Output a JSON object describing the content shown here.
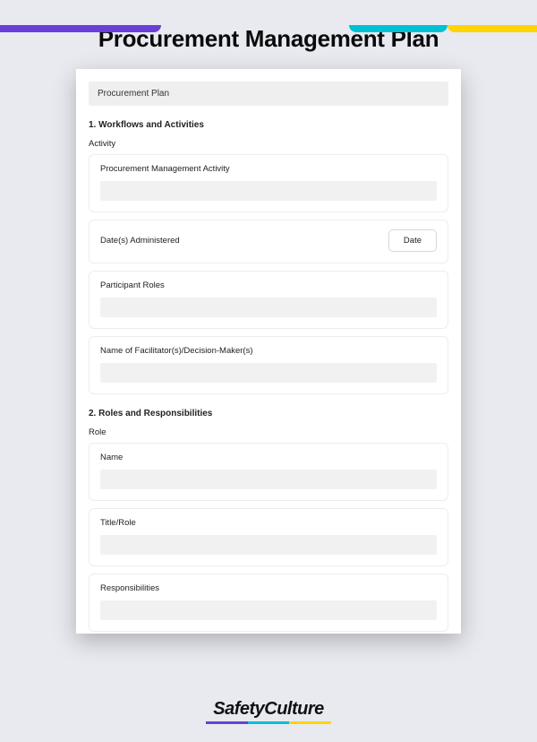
{
  "page": {
    "title": "Procurement Management Plan"
  },
  "form": {
    "header": "Procurement Plan",
    "sections": [
      {
        "heading": "1. Workflows and Activities",
        "group_label": "Activity",
        "cards": [
          {
            "label": "Procurement Management Activity",
            "type": "text"
          },
          {
            "label": "Date(s) Administered",
            "type": "date",
            "button": "Date"
          },
          {
            "label": "Participant Roles",
            "type": "text"
          },
          {
            "label": "Name of Facilitator(s)/Decision-Maker(s)",
            "type": "text"
          }
        ]
      },
      {
        "heading": "2. Roles and Responsibilities",
        "group_label": "Role",
        "cards": [
          {
            "label": "Name",
            "type": "text"
          },
          {
            "label": "Title/Role",
            "type": "text"
          },
          {
            "label": "Responsibilities",
            "type": "text"
          }
        ]
      }
    ]
  },
  "brand": {
    "name": "SafetyCulture"
  }
}
